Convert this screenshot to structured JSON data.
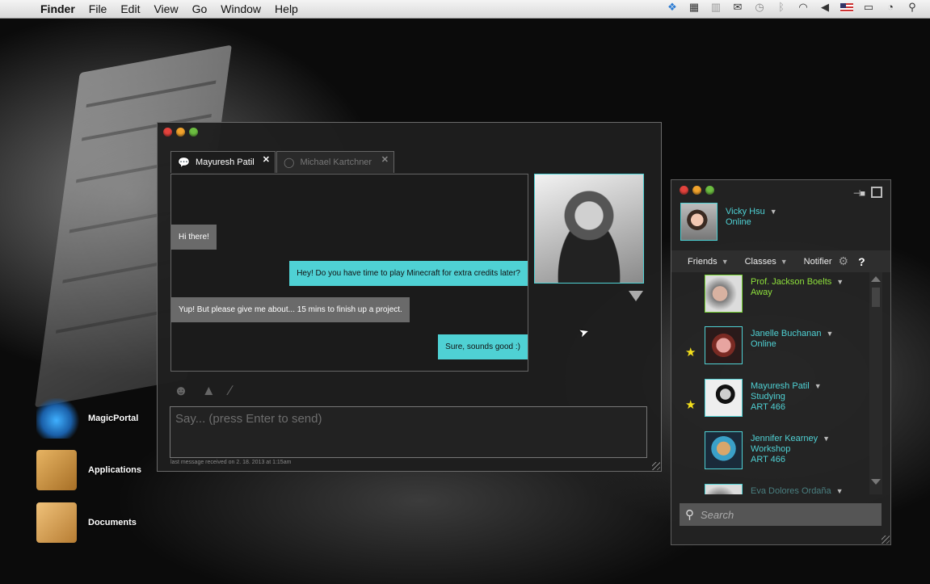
{
  "menubar": {
    "app": "Finder",
    "menus": [
      "File",
      "Edit",
      "View",
      "Go",
      "Window",
      "Help"
    ],
    "status_icons": [
      "dropbox-icon",
      "calendar-icon",
      "bars-icon",
      "mail-icon",
      "time-machine-icon",
      "bluetooth-icon",
      "wifi-icon",
      "volume-icon",
      "flag-icon",
      "battery-icon",
      "clock-icon",
      "spotlight-icon"
    ]
  },
  "desktop": {
    "icons": [
      {
        "label": "MagicPortal",
        "icon": "portal-icon"
      },
      {
        "label": "Applications",
        "icon": "applications-folder-icon"
      },
      {
        "label": "Documents",
        "icon": "documents-folder-icon"
      }
    ]
  },
  "chat": {
    "tabs": [
      {
        "label": "Mayuresh Patil",
        "active": true
      },
      {
        "label": "Michael Kartchner",
        "active": false
      }
    ],
    "messages": [
      {
        "text": "Hi there!",
        "from": "them"
      },
      {
        "text": "Hey! Do you have time to play Minecraft for extra credits later?",
        "from": "me"
      },
      {
        "text": "Yup! But please give me about... 15 mins to finish up a project.",
        "from": "them"
      },
      {
        "text": "Sure, sounds good :)",
        "from": "me"
      }
    ],
    "input_placeholder": "Say... (press Enter to send)",
    "last_message": "last message received on 2. 18. 2013 at 1:15am",
    "tools": [
      "smiley-icon",
      "bell-icon",
      "brush-icon"
    ],
    "colors": {
      "accent": "#4fd1d4",
      "incoming": "#6a6a6a"
    }
  },
  "buddy": {
    "me": {
      "name": "Vicky Hsu",
      "status": "Online"
    },
    "tabs": [
      "Friends",
      "Classes",
      "Notifier"
    ],
    "help_label": "?",
    "friends": [
      {
        "name": "Prof. Jackson Boelts",
        "status": "Away",
        "course": "",
        "favorite": false
      },
      {
        "name": "Janelle Buchanan",
        "status": "Online",
        "course": "",
        "favorite": true
      },
      {
        "name": "Mayuresh Patil",
        "status": "Studying",
        "course": "ART 466",
        "favorite": true
      },
      {
        "name": "Jennifer Kearney",
        "status": "Workshop",
        "course": "ART 466",
        "favorite": false
      },
      {
        "name": "Eva Dolores Ordaña",
        "status": "",
        "course": "",
        "favorite": false
      }
    ],
    "search_placeholder": "Search",
    "colors": {
      "online": "#4fd1d4",
      "away": "#8ee03c",
      "star": "#f4e01c"
    }
  }
}
